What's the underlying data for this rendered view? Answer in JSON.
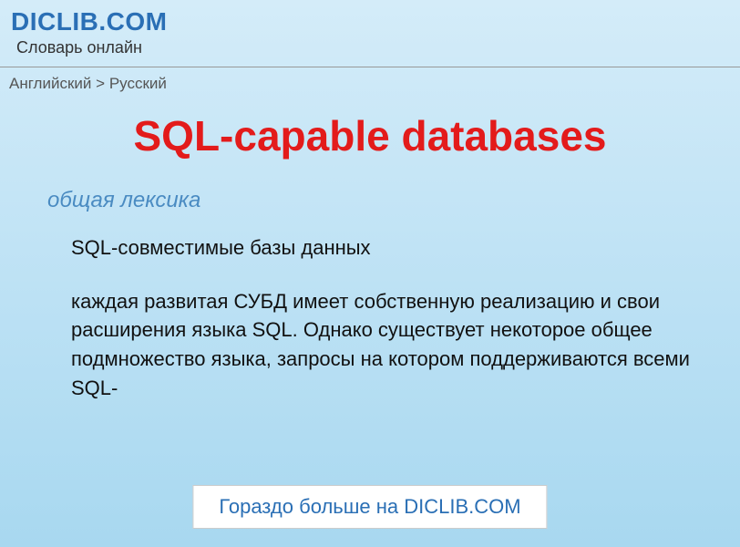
{
  "header": {
    "site_title": "DICLIB.COM",
    "site_subtitle": "Словарь онлайн"
  },
  "breadcrumb": {
    "from": "Английский",
    "separator": ">",
    "to": "Русский"
  },
  "entry": {
    "title": "SQL-capable databases",
    "category": "общая лексика",
    "definition": "SQL-совместимые базы данных",
    "description": "каждая развитая СУБД имеет собственную реализацию и свои расширения языка SQL. Однако существует некоторое общее подмножество языка, запросы на котором поддерживаются всеми SQL-"
  },
  "footer": {
    "more_link": "Гораздо больше на DICLIB.COM"
  }
}
